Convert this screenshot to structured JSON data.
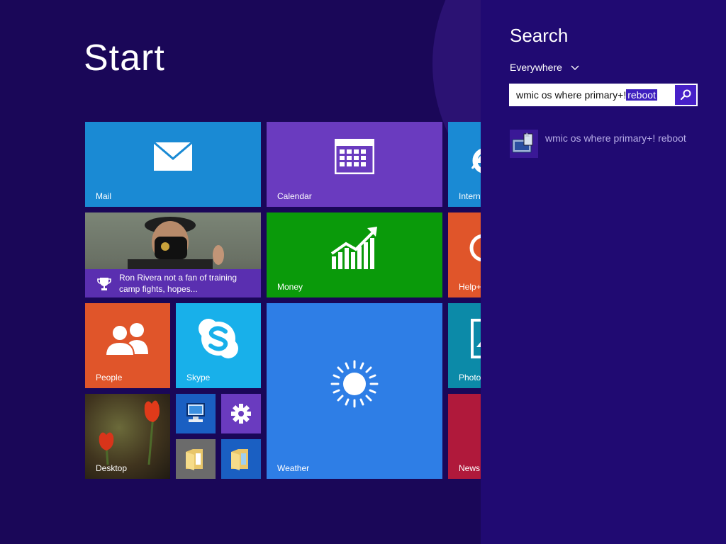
{
  "start": {
    "title": "Start"
  },
  "tiles": {
    "mail": "Mail",
    "calendar": "Calendar",
    "internet_explorer": "Intern",
    "news_sports": "Ron Rivera not a fan of training camp fights, hopes...",
    "money": "Money",
    "help": "Help+",
    "people": "People",
    "skype": "Skype",
    "weather": "Weather",
    "photos": "Photo",
    "desktop": "Desktop",
    "news": "News"
  },
  "search": {
    "title": "Search",
    "scope": "Everywhere",
    "query_text": "wmic os where primary+!",
    "query_selected": "reboot",
    "result_label": "wmic os where primary+! reboot"
  },
  "colors": {
    "start_background": "#1a0758",
    "search_pane": "#200a72",
    "mail": "#1a8ad4",
    "calendar": "#6a3bbf",
    "money": "#0a9a0a",
    "people": "#e0552a",
    "skype": "#18b0ea",
    "weather": "#2e7ee6",
    "help": "#e0552a",
    "photos": "#0c8aa8",
    "news": "#b0193b"
  },
  "icons": {
    "mail": "envelope-icon",
    "calendar": "calendar-icon",
    "internet_explorer": "internet-explorer-icon",
    "money": "chart-icon",
    "people": "people-icon",
    "skype": "skype-icon",
    "weather": "sun-icon",
    "search_submit": "magnifier-icon",
    "result": "command-prompt-icon"
  }
}
